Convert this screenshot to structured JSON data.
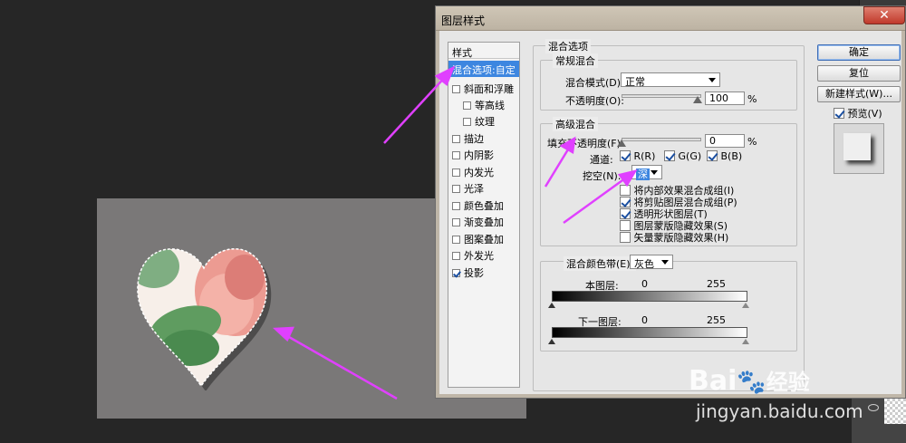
{
  "dialog": {
    "title": "图层样式",
    "close_glyph": "✕"
  },
  "style_list": {
    "header": "样式",
    "items": [
      {
        "label": "混合选项:自定",
        "selected": true,
        "checkbox": false,
        "checked": false,
        "indent": false
      },
      {
        "label": "斜面和浮雕",
        "checkbox": true,
        "checked": false,
        "indent": false
      },
      {
        "label": "等高线",
        "checkbox": true,
        "checked": false,
        "indent": true
      },
      {
        "label": "纹理",
        "checkbox": true,
        "checked": false,
        "indent": true
      },
      {
        "label": "描边",
        "checkbox": true,
        "checked": false,
        "indent": false
      },
      {
        "label": "内阴影",
        "checkbox": true,
        "checked": false,
        "indent": false
      },
      {
        "label": "内发光",
        "checkbox": true,
        "checked": false,
        "indent": false
      },
      {
        "label": "光泽",
        "checkbox": true,
        "checked": false,
        "indent": false
      },
      {
        "label": "颜色叠加",
        "checkbox": true,
        "checked": false,
        "indent": false
      },
      {
        "label": "渐变叠加",
        "checkbox": true,
        "checked": false,
        "indent": false
      },
      {
        "label": "图案叠加",
        "checkbox": true,
        "checked": false,
        "indent": false
      },
      {
        "label": "外发光",
        "checkbox": true,
        "checked": false,
        "indent": false
      },
      {
        "label": "投影",
        "checkbox": true,
        "checked": true,
        "indent": false
      }
    ]
  },
  "blend_options": {
    "title": "混合选项",
    "general": {
      "title": "常规混合",
      "blend_mode_label": "混合模式(D):",
      "blend_mode_value": "正常",
      "opacity_label": "不透明度(O):",
      "opacity_value": "100",
      "opacity_unit": "%",
      "opacity_level": 1.0
    },
    "advanced": {
      "title": "高级混合",
      "fill_opacity_label": "填充不透明度(F):",
      "fill_opacity_value": "0",
      "fill_opacity_unit": "%",
      "fill_opacity_level": 0.0,
      "channels_label": "通道:",
      "channels": [
        {
          "label": "R(R)",
          "checked": true
        },
        {
          "label": "G(G)",
          "checked": true
        },
        {
          "label": "B(B)",
          "checked": true
        }
      ],
      "knockout_label": "挖空(N):",
      "knockout_value": "深",
      "options": [
        {
          "label": "将内部效果混合成组(I)",
          "checked": false
        },
        {
          "label": "将剪贴图层混合成组(P)",
          "checked": true
        },
        {
          "label": "透明形状图层(T)",
          "checked": true
        },
        {
          "label": "图层蒙版隐藏效果(S)",
          "checked": false
        },
        {
          "label": "矢量蒙版隐藏效果(H)",
          "checked": false
        }
      ]
    },
    "blend_if": {
      "label": "混合颜色带(E):",
      "value": "灰色",
      "this_layer_label": "本图层:",
      "this_layer_low": "0",
      "this_layer_high": "255",
      "underlying_label": "下一图层:",
      "underlying_low": "0",
      "underlying_high": "255"
    }
  },
  "buttons": {
    "ok": "确定",
    "reset": "复位",
    "new_style": "新建样式(W)...",
    "preview_label": "预览(V)",
    "preview_checked": true
  },
  "watermark": {
    "brand_left": "Bai",
    "brand_right": "经验",
    "url": "jingyan.baidu.com"
  },
  "colors": {
    "selection": "#3d86e0",
    "annotation_arrow": "#e040ff",
    "canvas": "#7a7878",
    "workspace": "#262626"
  }
}
